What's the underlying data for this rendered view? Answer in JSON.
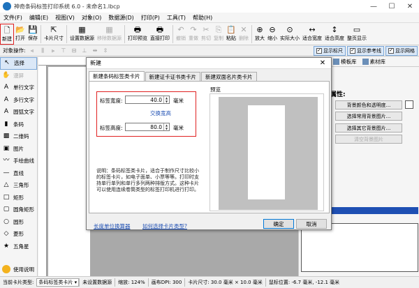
{
  "window": {
    "title": "神奇条码标签打印系统 6.0 - 未命名1.lbcp",
    "minimize": "—",
    "maximize": "☐",
    "close": "✕"
  },
  "menu": [
    "文件(F)",
    "编辑(E)",
    "视图(V)",
    "对象(O)",
    "数据源(D)",
    "打印(P)",
    "工具(T)",
    "帮助(H)"
  ],
  "toolbar": [
    {
      "label": "新建",
      "icon": "new-file-icon",
      "glyph": "🗋",
      "highlighted": true,
      "disabled": false
    },
    {
      "label": "打开",
      "icon": "open-folder-icon",
      "glyph": "📂",
      "disabled": false
    },
    {
      "label": "保存",
      "icon": "save-icon",
      "glyph": "💾",
      "disabled": false
    },
    {
      "sep": true
    },
    {
      "label": "卡片尺寸",
      "icon": "card-size-icon",
      "glyph": "⇱",
      "disabled": false
    },
    {
      "sep": true
    },
    {
      "label": "设置数据源",
      "icon": "data-source-icon",
      "glyph": "▦",
      "disabled": false
    },
    {
      "label": "移除数据源",
      "icon": "remove-data-source-icon",
      "glyph": "▦",
      "disabled": true
    },
    {
      "sep": true
    },
    {
      "label": "打印预览",
      "icon": "print-preview-icon",
      "glyph": "🖶",
      "disabled": false
    },
    {
      "label": "直接打印",
      "icon": "print-icon",
      "glyph": "🖶",
      "disabled": false
    },
    {
      "sep": true
    },
    {
      "label": "撤销",
      "icon": "undo-icon",
      "glyph": "↶",
      "disabled": true
    },
    {
      "label": "重做",
      "icon": "redo-icon",
      "glyph": "↷",
      "disabled": true
    },
    {
      "label": "剪切",
      "icon": "cut-icon",
      "glyph": "✂",
      "disabled": true
    },
    {
      "label": "复制",
      "icon": "copy-icon",
      "glyph": "⎘",
      "disabled": true
    },
    {
      "label": "粘贴",
      "icon": "paste-icon",
      "glyph": "📋",
      "disabled": false
    },
    {
      "label": "删除",
      "icon": "delete-icon",
      "glyph": "✕",
      "disabled": true
    },
    {
      "sep": true
    },
    {
      "label": "放大",
      "icon": "zoom-in-icon",
      "glyph": "⊕",
      "disabled": false
    },
    {
      "label": "缩小",
      "icon": "zoom-out-icon",
      "glyph": "⊖",
      "disabled": false
    },
    {
      "label": "实际大小",
      "icon": "actual-size-icon",
      "glyph": "⊙",
      "disabled": false
    },
    {
      "label": "适合宽度",
      "icon": "fit-width-icon",
      "glyph": "↔",
      "disabled": false
    },
    {
      "label": "适合高度",
      "icon": "fit-height-icon",
      "glyph": "↕",
      "disabled": false
    },
    {
      "label": "整页显示",
      "icon": "full-page-icon",
      "glyph": "▭",
      "disabled": false
    }
  ],
  "options_bar": {
    "label": "对象操作:",
    "toggles": [
      "显示标尺",
      "显示参考线",
      "显示网格"
    ]
  },
  "tools": [
    {
      "label": "选择",
      "icon": "select-arrow-icon",
      "glyph": "↖",
      "active": true
    },
    {
      "label": "漫屏",
      "icon": "pan-hand-icon",
      "glyph": "✋",
      "disabled": true
    },
    {
      "label": "单行文字",
      "icon": "single-line-text-icon",
      "glyph": "A"
    },
    {
      "label": "多行文字",
      "icon": "multi-line-text-icon",
      "glyph": "A"
    },
    {
      "label": "圆弧文字",
      "icon": "arc-text-icon",
      "glyph": "A"
    },
    {
      "label": "条码",
      "icon": "barcode-icon",
      "glyph": "▮"
    },
    {
      "label": "二维码",
      "icon": "qrcode-icon",
      "glyph": "▩"
    },
    {
      "label": "图片",
      "icon": "image-icon",
      "glyph": "▣"
    },
    {
      "label": "手绘曲线",
      "icon": "freehand-icon",
      "glyph": "〰"
    },
    {
      "label": "直线",
      "icon": "line-icon",
      "glyph": "—"
    },
    {
      "label": "三角形",
      "icon": "triangle-icon",
      "glyph": "△"
    },
    {
      "label": "矩形",
      "icon": "rectangle-icon",
      "glyph": "□"
    },
    {
      "label": "圆角矩形",
      "icon": "rounded-rect-icon",
      "glyph": "▢"
    },
    {
      "label": "圆形",
      "icon": "circle-icon",
      "glyph": "○"
    },
    {
      "label": "菱形",
      "icon": "diamond-icon",
      "glyph": "◇"
    },
    {
      "label": "五角星",
      "icon": "star-icon",
      "glyph": "★"
    }
  ],
  "tools_help": "使用说明",
  "right_panel": {
    "tabs": [
      "模板库",
      "素材库"
    ],
    "section_title": "属性:",
    "buttons": [
      "背景颜色和透明度...",
      "选择常用背景图片...",
      "选择其它背景图片...",
      "清空背景图片"
    ]
  },
  "dialog": {
    "title": "新建",
    "close": "✕",
    "tabs": [
      "新建条码标签类卡片",
      "新建证卡证书类卡片",
      "新建双面名片类卡片"
    ],
    "width_label": "标签宽度:",
    "width_value": "40.0",
    "height_label": "标签高度:",
    "height_value": "80.0",
    "unit": "毫米",
    "swap": "交换宽高",
    "description": "说明：条码标签类卡片，适合于制作尺寸比较小的标签卡片，如电子面单、小票等等。打印时支持单行单列和单行多列两种排版方式。这种卡片可以使用连续卷筒类型的标签打印机进行打印。",
    "preview_label": "预览",
    "link_units": "长度单位换算器",
    "link_type": "如何选择卡片类型?",
    "ok": "确定",
    "cancel": "取消"
  },
  "status": {
    "card_type_label": "当前卡片类型:",
    "card_type_value": "条码标签类卡片",
    "data_source": "未设置数据源",
    "zoom": "缩放: 124%",
    "dpi": "画布DPI: 300",
    "card_size": "卡片尺寸: 30.0 毫米 × 10.0 毫米",
    "mouse": "鼠标位置: -6.7 毫米, -12.1 毫米"
  },
  "colors": {
    "accent": "#1e73be",
    "highlight": "#e02020",
    "link": "#1e4fb3"
  }
}
